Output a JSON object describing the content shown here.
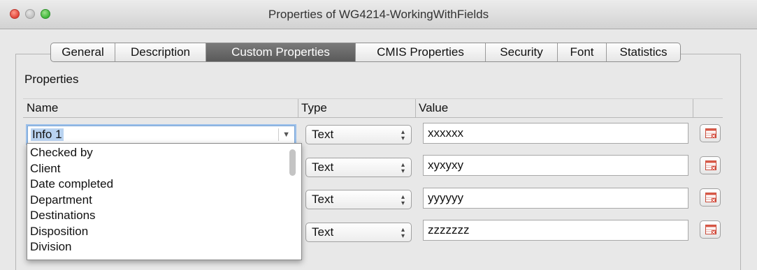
{
  "window": {
    "title": "Properties of WG4214-WorkingWithFields"
  },
  "tabs": [
    {
      "label": "General"
    },
    {
      "label": "Description"
    },
    {
      "label": "Custom Properties"
    },
    {
      "label": "CMIS Properties"
    },
    {
      "label": "Security"
    },
    {
      "label": "Font"
    },
    {
      "label": "Statistics"
    }
  ],
  "active_tab": "Custom Properties",
  "section": {
    "label": "Properties"
  },
  "columns": {
    "name": "Name",
    "type": "Type",
    "value": "Value"
  },
  "name_combo": {
    "value": "Info 1"
  },
  "dropdown": {
    "options": [
      "Checked by",
      "Client",
      "Date completed",
      "Department",
      "Destinations",
      "Disposition",
      "Division"
    ]
  },
  "rows": [
    {
      "type": "Text",
      "value": "xxxxxx"
    },
    {
      "type": "Text",
      "value": "xyxyxy"
    },
    {
      "type": "Text",
      "value": "yyyyyy"
    },
    {
      "type": "Text",
      "value": "zzzzzzz"
    }
  ],
  "icons": {
    "delete": "delete-property-icon"
  },
  "colors": {
    "active_tab": "#666666",
    "selection": "#b9d3f0",
    "focus_ring": "#9cc0ea",
    "delete_icon": "#d03a2a"
  }
}
